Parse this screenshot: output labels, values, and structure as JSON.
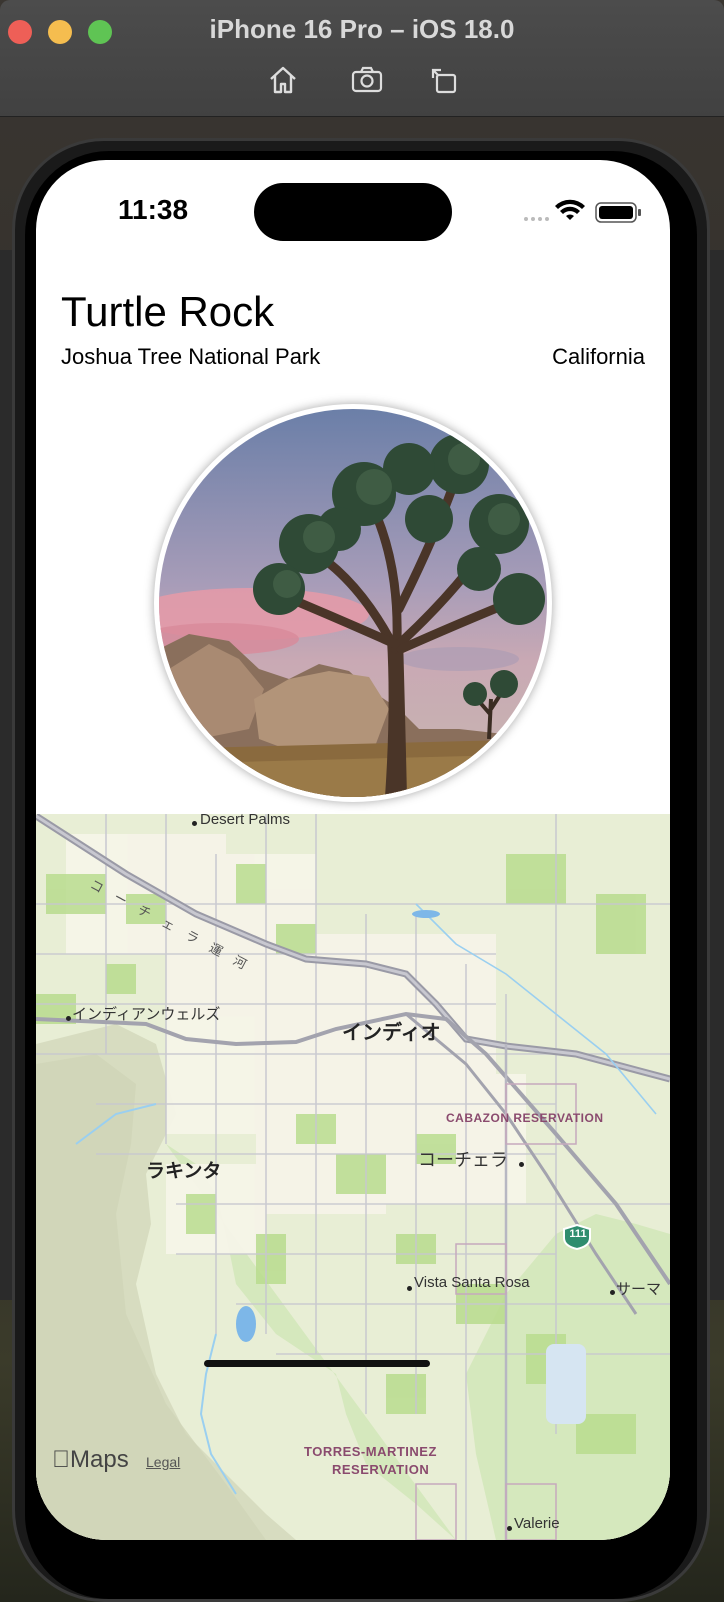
{
  "window": {
    "title": "iPhone 16 Pro – iOS 18.0",
    "toolbar_icons": [
      "home-icon",
      "screenshot-camera-icon",
      "rotate-icon"
    ]
  },
  "status_bar": {
    "time": "11:38",
    "icons": [
      "signal-icon",
      "wifi-icon",
      "battery-icon"
    ]
  },
  "landmark": {
    "name": "Turtle Rock",
    "park": "Joshua Tree National Park",
    "state": "California"
  },
  "map": {
    "labels": {
      "desert_palms": "Desert Palms",
      "coachella_canal": "コーチェラ運河",
      "indian_wells": "インディアンウェルズ",
      "indio": "インディオ",
      "cabazon": "CABAZON RESERVATION",
      "la_quinta": "ラキンタ",
      "coachella": "コーチェラ",
      "route": "111",
      "vista_santa_rosa": "Vista Santa Rosa",
      "thermal": "サーマ",
      "torres_martinez_1": "TORRES-MARTINEZ",
      "torres_martinez_2": "RESERVATION",
      "valerie": "Valerie"
    },
    "brand": "Maps",
    "legal": "Legal"
  }
}
